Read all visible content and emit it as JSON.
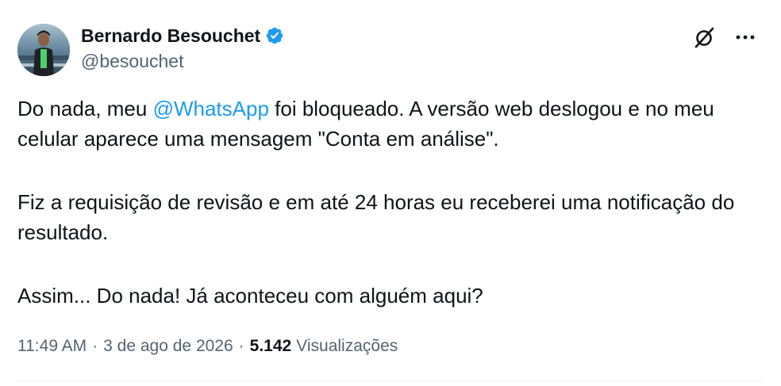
{
  "author": {
    "display_name": "Bernardo Besouchet",
    "handle": "@besouchet",
    "verified": true
  },
  "tweet": {
    "line1_before": "Do nada, meu ",
    "mention": "@WhatsApp",
    "line1_after": " foi bloqueado. A versão web deslogou e no meu celular aparece uma mensagem \"Conta em análise\".",
    "paragraph2": "Fiz a requisição de revisão e em até 24 horas eu receberei uma notificação do resultado.",
    "paragraph3": "Assim... Do nada! Já aconteceu com alguém aqui?"
  },
  "meta": {
    "time": "11:49 AM",
    "separator": "·",
    "date": "3 de ago de 2026",
    "views_count": "5.142",
    "views_label": "Visualizações"
  },
  "icons": {
    "verified": "verified-badge-icon",
    "grok": "grok-icon",
    "more": "more-options-icon"
  },
  "colors": {
    "accent": "#1d9bf0",
    "text_primary": "#0f1419",
    "text_secondary": "#536471"
  }
}
